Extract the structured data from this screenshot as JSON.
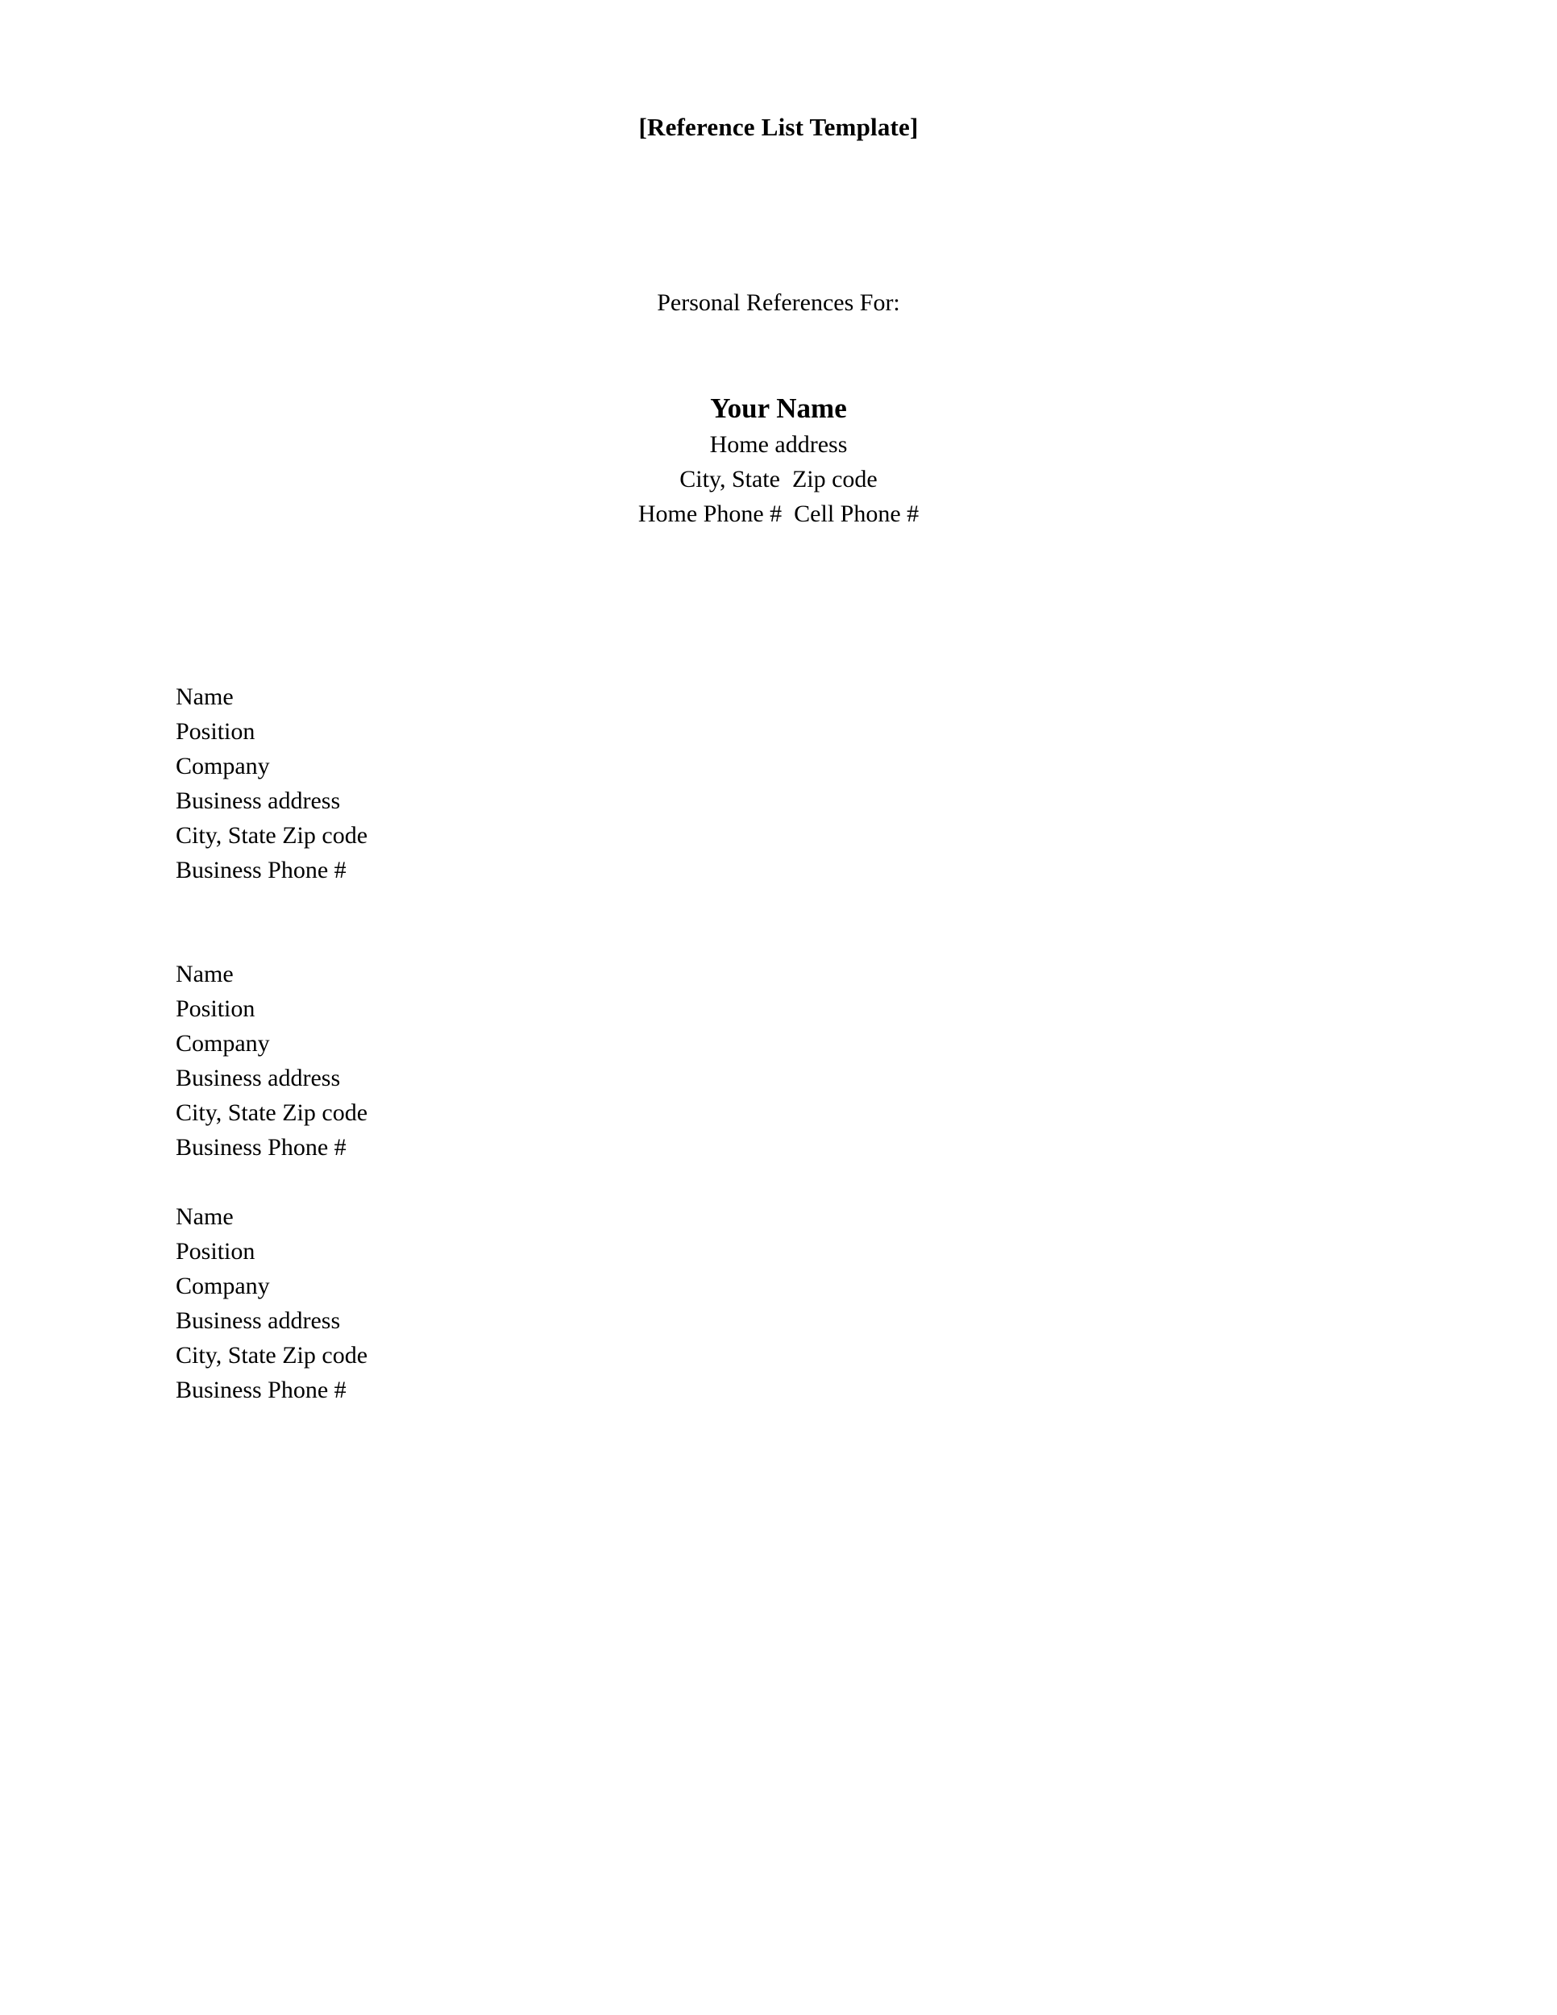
{
  "document": {
    "title": "[Reference List Template]",
    "subject_line": "Personal References For:"
  },
  "owner": {
    "name": "Your Name",
    "address": "Home address",
    "city_state_zip": "City, State  Zip code",
    "phones": "Home Phone #  Cell Phone #"
  },
  "reference_blocks": [
    {
      "name": "Name",
      "position": "Position",
      "company": "Company",
      "business_address": "Business address",
      "city_state_zip": "City, State Zip code",
      "business_phone": "Business Phone #"
    },
    {
      "name": "Name",
      "position": "Position",
      "company": "Company",
      "business_address": "Business address",
      "city_state_zip": "City, State Zip code",
      "business_phone": "Business Phone #"
    },
    {
      "name": "Name",
      "position": "Position",
      "company": "Company",
      "business_address": "Business address",
      "city_state_zip": "City, State Zip code",
      "business_phone": "Business Phone #"
    }
  ],
  "colors": {
    "page_background": "#ffffff",
    "text": "#000000"
  }
}
